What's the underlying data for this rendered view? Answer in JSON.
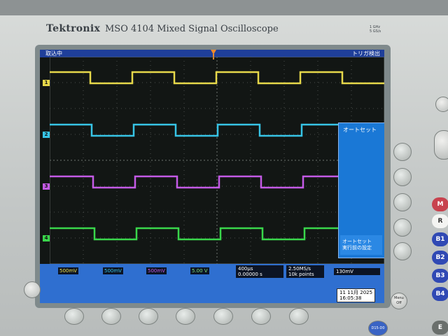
{
  "device": {
    "brand": "Tektronix",
    "model": "MSO 4104  Mixed Signal Oscilloscope",
    "spec_lines": [
      "1 GHz",
      "5 GS/s"
    ]
  },
  "status": {
    "left": "取込中",
    "right": "トリガ検出"
  },
  "channel_markers": [
    "1",
    "2",
    "3",
    "4"
  ],
  "menu": {
    "title": "オートセット",
    "undo_label": "オートセット\n実行前の設定"
  },
  "readout": {
    "ch1": "500mV",
    "ch2": "500mV",
    "ch3": "500mV",
    "ch4": "5.00 V",
    "timebase": "400μs",
    "position": "0.00000 s",
    "sample_rate": "2.50MS/s",
    "record_length": "10k points",
    "trigger": "130mV",
    "date": "11 11月 2025",
    "time": "16:05:38"
  },
  "buttons": {
    "menu_off": "Menu Off",
    "d15": "D15-D0",
    "m": "M",
    "r": "R",
    "b1": "B1",
    "b2": "B2",
    "b3": "B3",
    "b4": "B4",
    "e": "E"
  },
  "colors": {
    "ch1": "#e6d84a",
    "ch2": "#37c4e6",
    "ch3": "#c45ae6",
    "ch4": "#39d64b",
    "ch4_readout": "#7fe07a"
  }
}
